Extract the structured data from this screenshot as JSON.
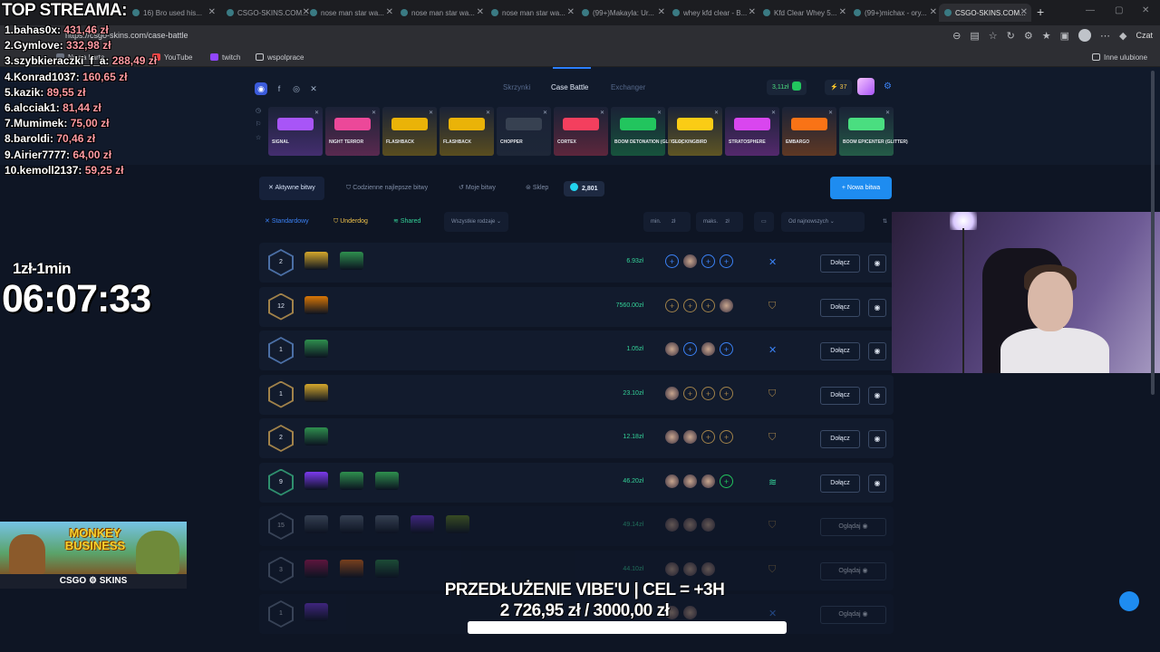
{
  "browser": {
    "tabs": [
      {
        "label": "16) Bro used his...",
        "active": false
      },
      {
        "label": "CSGO-SKINS.COM...",
        "active": false
      },
      {
        "label": "nose man star wa...",
        "active": false
      },
      {
        "label": "nose man star wa...",
        "active": false
      },
      {
        "label": "nose man star wa...",
        "active": false
      },
      {
        "label": "(99+)Makayla: Ur...",
        "active": false
      },
      {
        "label": "whey kfd clear - B...",
        "active": false
      },
      {
        "label": "Kfd Clear Whey 5...",
        "active": false
      },
      {
        "label": "(99+)michax - ory...",
        "active": false
      },
      {
        "label": "CSGO-SKINS.COM...",
        "active": true
      }
    ],
    "url": "https://csgo-skins.com/case-battle",
    "chat_label": "Czat",
    "bookmarks": [
      "Nowa karta",
      "YouTube",
      "twitch",
      "wspolprace"
    ],
    "other_bookmarks": "Inne ulubione"
  },
  "site": {
    "nav": {
      "cases": "Skrzynki",
      "case_battle": "Case Battle",
      "exchanger": "Exchanger"
    },
    "balance": "3,11zł",
    "coins": "37",
    "drops": [
      {
        "name": "SIGNAL",
        "color": "#a855f7"
      },
      {
        "name": "NIGHT TERROR",
        "color": "#ec4899"
      },
      {
        "name": "FLASHBACK",
        "color": "#eab308"
      },
      {
        "name": "FLASHBACK",
        "color": "#eab308"
      },
      {
        "name": "CHOPPER",
        "color": "#374151"
      },
      {
        "name": "CORTEX",
        "color": "#f43f5e"
      },
      {
        "name": "BOOM DETONATION (GLITTER)",
        "color": "#22c55e"
      },
      {
        "name": "GLOCKINGBIRD",
        "color": "#facc15"
      },
      {
        "name": "STRATOSPHERE",
        "color": "#d946ef"
      },
      {
        "name": "EMBARGO",
        "color": "#f97316"
      },
      {
        "name": "BOOM EPICENTER (GLITTER)",
        "color": "#4ade80"
      }
    ],
    "tabs": {
      "active": "Aktywne bitwy",
      "best_today": "Codzienne najlepsze bitwy",
      "mine": "Moje bitwy",
      "shop": "Sklep",
      "count": "2,801",
      "new_battle": "Nowa bitwa"
    },
    "filters": {
      "standard": "Standardowy",
      "underdog": "Underdog",
      "shared": "Shared",
      "all_types": "Wszystkie rodzaje",
      "min": "min.",
      "max": "maks.",
      "currency": "zł",
      "sort": "Od najnowszych"
    },
    "join_label": "Dołącz",
    "watch_label": "Oglądaj",
    "battles": [
      {
        "round": "2",
        "price": "6.93zł",
        "hex": "#4b6fa5",
        "cases": [
          "#d4a72c",
          "#2f8f4e"
        ],
        "mode": "crossed",
        "slots": [
          "+",
          "av",
          "+",
          "+"
        ],
        "slot_color": "#3b82f6",
        "action": "join",
        "dim": false
      },
      {
        "round": "12",
        "price": "7560.00zł",
        "hex": "#a1824a",
        "cases": [
          "#d97706"
        ],
        "mode": "shield",
        "slots": [
          "+",
          "+",
          "+",
          "av"
        ],
        "slot_color": "#a1824a",
        "action": "join",
        "dim": false
      },
      {
        "round": "1",
        "price": "1.05zł",
        "hex": "#4b6fa5",
        "cases": [
          "#2f8f4e"
        ],
        "mode": "crossed",
        "slots": [
          "av",
          "+",
          "av",
          "+"
        ],
        "slot_color": "#3b82f6",
        "action": "join",
        "dim": false
      },
      {
        "round": "1",
        "price": "23.10zł",
        "hex": "#a1824a",
        "cases": [
          "#d4a72c"
        ],
        "mode": "shield",
        "slots": [
          "av",
          "+",
          "+",
          "+"
        ],
        "slot_color": "#a1824a",
        "action": "join",
        "dim": false
      },
      {
        "round": "2",
        "price": "12.18zł",
        "hex": "#a1824a",
        "cases": [
          "#2f8f4e"
        ],
        "mode": "shield",
        "slots": [
          "av",
          "av",
          "+",
          "+"
        ],
        "slot_color": "#a1824a",
        "action": "join",
        "dim": false
      },
      {
        "round": "9",
        "price": "46.20zł",
        "hex": "#2f8f6e",
        "cases": [
          "#7c3aed",
          "#2f8f4e",
          "#2f8f4e"
        ],
        "mode": "shared",
        "slots": [
          "av",
          "av",
          "av",
          "+"
        ],
        "slot_color": "#22c55e",
        "action": "join",
        "dim": false
      },
      {
        "round": "15",
        "price": "49.14zł",
        "hex": "#6b7b96",
        "cases": [
          "#64748b",
          "#64748b",
          "#64748b",
          "#7c3aed",
          "#6b8e23"
        ],
        "mode": "shield",
        "slots": [
          "av",
          "av",
          "av"
        ],
        "slot_color": "#4b6fa5",
        "action": "watch",
        "dim": true
      },
      {
        "round": "3",
        "price": "44.10zł",
        "hex": "#6b7b96",
        "cases": [
          "#be185d",
          "#f97316",
          "#2f8f4e"
        ],
        "mode": "shield",
        "slots": [
          "av",
          "av",
          "av"
        ],
        "slot_color": "#4b6fa5",
        "action": "watch",
        "dim": true
      },
      {
        "round": "1",
        "price": "",
        "hex": "#6b7b96",
        "cases": [
          "#7c3aed"
        ],
        "mode": "crossed",
        "slots": [
          "av",
          "av"
        ],
        "slot_color": "#4b6fa5",
        "action": "watch",
        "dim": true
      }
    ]
  },
  "overlay": {
    "top_title": "TOP STREAMA:",
    "leaderboard": [
      {
        "name": "1.bahas0x:",
        "amount": "431,46 zł"
      },
      {
        "name": "2.Gymlove:",
        "amount": "332,98 zł"
      },
      {
        "name": "3.szybkieraczki_f_a:",
        "amount": "288,49 zł"
      },
      {
        "name": "4.Konrad1037:",
        "amount": "160,65 zł"
      },
      {
        "name": "5.kazik:",
        "amount": "89,55 zł"
      },
      {
        "name": "6.alcciak1:",
        "amount": "81,44 zł"
      },
      {
        "name": "7.Mumimek:",
        "amount": "75,00 zł"
      },
      {
        "name": "8.baroldi:",
        "amount": "70,46 zł"
      },
      {
        "name": "9.Airier7777:",
        "amount": "64,00 zł"
      },
      {
        "name": "10.kemoll2137:",
        "amount": "59,25 zł"
      }
    ],
    "rate": "1zł-1min",
    "timer": "06:07:33",
    "promo_title": "MONKEY BUSINESS",
    "promo_brand": "CSGO ⚙ SKINS",
    "goal_title": "PRZEDŁUŻENIE VIBE'U | CEL = +3H",
    "goal_amount": "2 726,95 zł / 3000,00 zł",
    "goal_progress": 0.909
  }
}
